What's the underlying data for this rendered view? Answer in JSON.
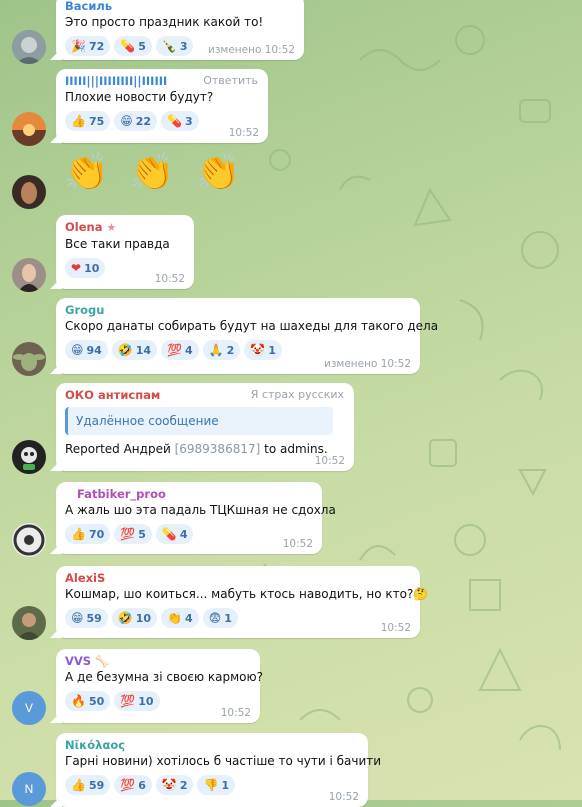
{
  "messages": [
    {
      "sender": "Василь",
      "sender_color": "#3b86d6",
      "text": "Это просто праздник какой то!",
      "time": "изменено 10:52",
      "reactions": [
        {
          "emoji": "🎉",
          "count": "72"
        },
        {
          "emoji": "💊",
          "count": "5"
        },
        {
          "emoji": "🍾",
          "count": "3"
        }
      ]
    },
    {
      "sender": "ІІІІІ|||ІІІІІІІІ||ІІІІІІ",
      "sender_color": "#3b86d6",
      "reply_label": "Ответить",
      "text": "Плохие новости будут?",
      "time": "10:52",
      "reactions": [
        {
          "emoji": "👍",
          "count": "75"
        },
        {
          "emoji": "😁",
          "count": "22"
        },
        {
          "emoji": "💊",
          "count": "3"
        }
      ]
    },
    {
      "claps": [
        "👏",
        "👏",
        "👏"
      ]
    },
    {
      "sender": "Olena",
      "sender_color": "#d64a4a",
      "star": "★",
      "text": "Все таки правда",
      "time": "10:52",
      "reactions": [
        {
          "emoji": "❤",
          "count": "10"
        }
      ]
    },
    {
      "sender": "Grogu",
      "sender_color": "#3aa6a0",
      "text": "Скоро данаты собирать будут  на шахеды для такого дела",
      "time": "изменено 10:52",
      "reactions": [
        {
          "emoji": "😁",
          "count": "94"
        },
        {
          "emoji": "🤣",
          "count": "14"
        },
        {
          "emoji": "💯",
          "count": "4"
        },
        {
          "emoji": "🙏",
          "count": "2"
        },
        {
          "emoji": "🤡",
          "count": "1"
        }
      ]
    },
    {
      "sender": "ОКО антиспам",
      "sender_color": "#d64a4a",
      "reply_label": "Я страх русских",
      "deleted": "Удалённое сообщение",
      "report_prefix": "Reported Андрей",
      "report_id": "[6989386817]",
      "report_suffix": "to admins.",
      "time": "10:52"
    },
    {
      "sender": "Fatbiker_proo",
      "sender_color": "#b04fb5",
      "text": "А жаль шо эта падаль ТЦКшная не сдохла",
      "time": "10:52",
      "reactions": [
        {
          "emoji": "👍",
          "count": "70"
        },
        {
          "emoji": "💯",
          "count": "5"
        },
        {
          "emoji": "💊",
          "count": "4"
        }
      ]
    },
    {
      "sender": "AlexiS",
      "sender_color": "#d64a4a",
      "text": "Кошмар, шо коиться... мабуть ктось наводить, но кто?🤔",
      "time": "10:52",
      "reactions": [
        {
          "emoji": "😁",
          "count": "59"
        },
        {
          "emoji": "🤣",
          "count": "10"
        },
        {
          "emoji": "👏",
          "count": "4"
        },
        {
          "emoji": "😨",
          "count": "1"
        }
      ]
    },
    {
      "sender": "VVS",
      "sender_color": "#8a5bd6",
      "bone": "🦴",
      "text": "А де безумна зі своєю кармою?",
      "time": "10:52",
      "avatar_letter": "V",
      "reactions": [
        {
          "emoji": "🔥",
          "count": "50"
        },
        {
          "emoji": "💯",
          "count": "10"
        }
      ]
    },
    {
      "sender": "Νῖκόλαος",
      "sender_color": "#3aa6a0",
      "text": "Гарні новини) хотілось б частіше то чути і бачити",
      "time": "10:52",
      "avatar_letter": "N",
      "reactions": [
        {
          "emoji": "👍",
          "count": "59"
        },
        {
          "emoji": "💯",
          "count": "6"
        },
        {
          "emoji": "🤡",
          "count": "2"
        },
        {
          "emoji": "👎",
          "count": "1"
        }
      ]
    }
  ]
}
